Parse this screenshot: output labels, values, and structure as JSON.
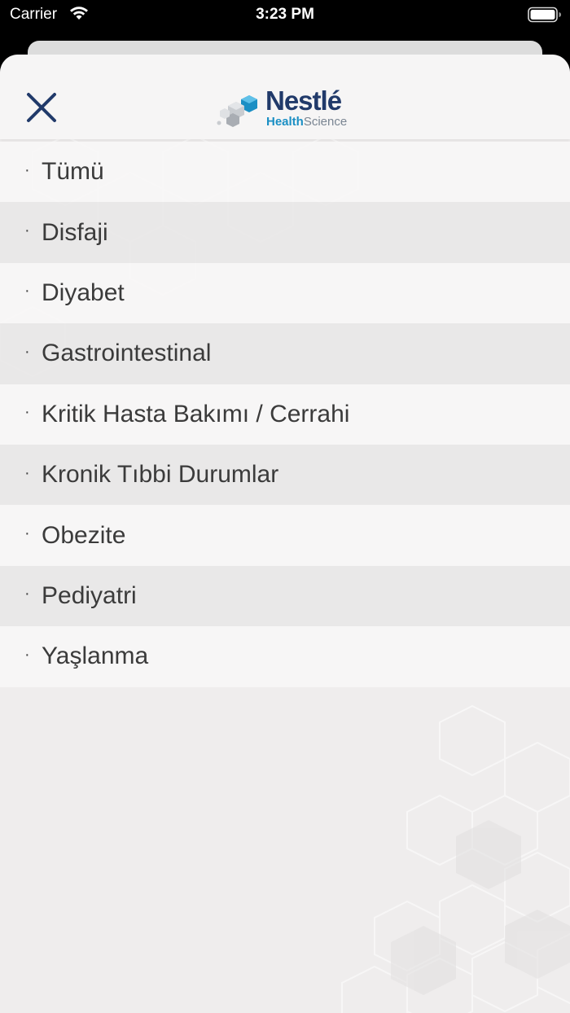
{
  "status_bar": {
    "carrier": "Carrier",
    "time": "3:23 PM"
  },
  "header": {
    "close_icon": "close-icon",
    "logo": {
      "brand": "Nestlé",
      "sub_a": "Health",
      "sub_b": "Science"
    }
  },
  "menu": {
    "bullet": "·",
    "items": [
      {
        "label": "Tümü"
      },
      {
        "label": "Disfaji"
      },
      {
        "label": "Diyabet"
      },
      {
        "label": "Gastrointestinal"
      },
      {
        "label": "Kritik Hasta Bakımı / Cerrahi"
      },
      {
        "label": "Kronik Tıbbi Durumlar"
      },
      {
        "label": "Obezite"
      },
      {
        "label": "Pediyatri"
      },
      {
        "label": "Yaşlanma"
      }
    ]
  },
  "colors": {
    "brand_navy": "#213a6a",
    "brand_blue": "#1b8fc4",
    "close_icon": "#213a6a"
  }
}
